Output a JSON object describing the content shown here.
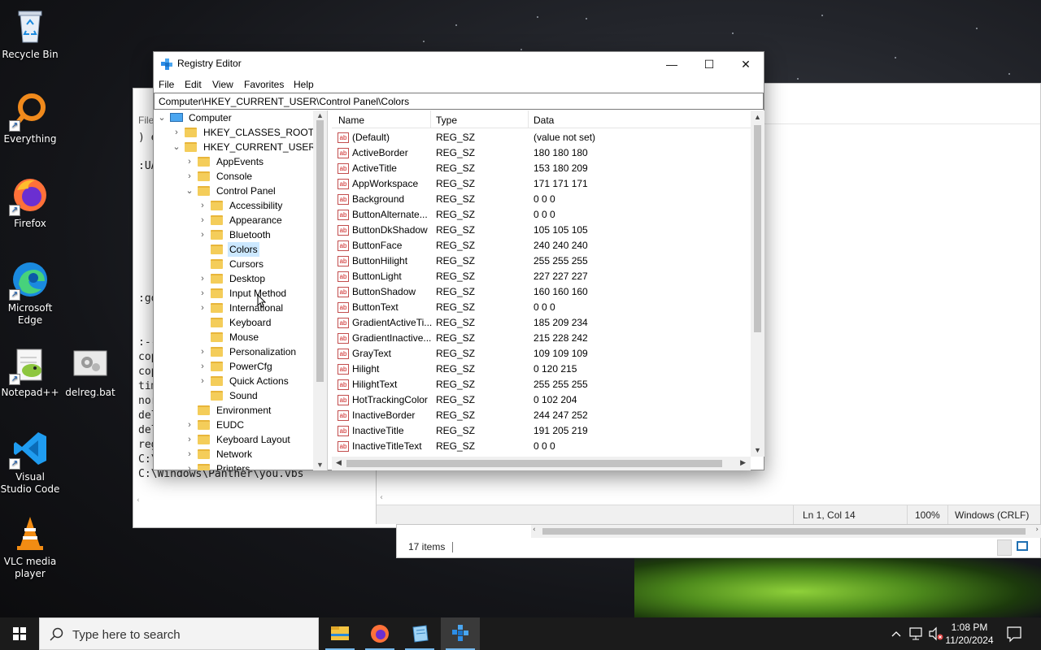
{
  "desktop": {
    "icons": [
      {
        "label": "Recycle Bin"
      },
      {
        "label": "Everything"
      },
      {
        "label": "Firefox"
      },
      {
        "label": "Microsoft Edge"
      },
      {
        "label": "Notepad++"
      },
      {
        "label": "delreg.bat"
      },
      {
        "label": "Visual Studio Code"
      },
      {
        "label": "VLC media player"
      }
    ]
  },
  "notepad_back": {
    "menu_file": "File",
    "lines": [
      ") e",
      ":UA",
      ":go",
      ":--",
      "cop",
      "cop",
      "tim",
      "nor",
      "del",
      "del",
      "reg",
      "C:\\",
      "C:\\Windows\\Panther\\you.vbs"
    ],
    "status": {
      "position": "Ln 1, Col 14",
      "zoom": "100%",
      "line_ending": "Windows (CRLF)"
    }
  },
  "explorer_strip": {
    "items_count": "17 items"
  },
  "regedit": {
    "title": "Registry Editor",
    "menu": [
      "File",
      "Edit",
      "View",
      "Favorites",
      "Help"
    ],
    "address": "Computer\\HKEY_CURRENT_USER\\Control Panel\\Colors",
    "tree": [
      {
        "label": "Computer",
        "level": 0,
        "expander": "v"
      },
      {
        "label": "HKEY_CLASSES_ROOT",
        "level": 1,
        "expander": ">"
      },
      {
        "label": "HKEY_CURRENT_USER",
        "level": 1,
        "expander": "v"
      },
      {
        "label": "AppEvents",
        "level": 2,
        "expander": ">"
      },
      {
        "label": "Console",
        "level": 2,
        "expander": ">"
      },
      {
        "label": "Control Panel",
        "level": 2,
        "expander": "v"
      },
      {
        "label": "Accessibility",
        "level": 3,
        "expander": ">"
      },
      {
        "label": "Appearance",
        "level": 3,
        "expander": ">"
      },
      {
        "label": "Bluetooth",
        "level": 3,
        "expander": ">"
      },
      {
        "label": "Colors",
        "level": 3,
        "expander": "",
        "selected": true
      },
      {
        "label": "Cursors",
        "level": 3,
        "expander": ""
      },
      {
        "label": "Desktop",
        "level": 3,
        "expander": ">"
      },
      {
        "label": "Input Method",
        "level": 3,
        "expander": ">"
      },
      {
        "label": "International",
        "level": 3,
        "expander": ">"
      },
      {
        "label": "Keyboard",
        "level": 3,
        "expander": ""
      },
      {
        "label": "Mouse",
        "level": 3,
        "expander": ""
      },
      {
        "label": "Personalization",
        "level": 3,
        "expander": ">"
      },
      {
        "label": "PowerCfg",
        "level": 3,
        "expander": ">"
      },
      {
        "label": "Quick Actions",
        "level": 3,
        "expander": ">"
      },
      {
        "label": "Sound",
        "level": 3,
        "expander": ""
      },
      {
        "label": "Environment",
        "level": 2,
        "expander": ""
      },
      {
        "label": "EUDC",
        "level": 2,
        "expander": ">"
      },
      {
        "label": "Keyboard Layout",
        "level": 2,
        "expander": ">"
      },
      {
        "label": "Network",
        "level": 2,
        "expander": ">"
      },
      {
        "label": "Printers",
        "level": 2,
        "expander": ">"
      }
    ],
    "columns": [
      "Name",
      "Type",
      "Data"
    ],
    "values": [
      {
        "name": "(Default)",
        "type": "REG_SZ",
        "data": "(value not set)"
      },
      {
        "name": "ActiveBorder",
        "type": "REG_SZ",
        "data": "180 180 180"
      },
      {
        "name": "ActiveTitle",
        "type": "REG_SZ",
        "data": "153 180 209"
      },
      {
        "name": "AppWorkspace",
        "type": "REG_SZ",
        "data": "171 171 171"
      },
      {
        "name": "Background",
        "type": "REG_SZ",
        "data": "0 0 0"
      },
      {
        "name": "ButtonAlternate...",
        "type": "REG_SZ",
        "data": "0 0 0"
      },
      {
        "name": "ButtonDkShadow",
        "type": "REG_SZ",
        "data": "105 105 105"
      },
      {
        "name": "ButtonFace",
        "type": "REG_SZ",
        "data": "240 240 240"
      },
      {
        "name": "ButtonHilight",
        "type": "REG_SZ",
        "data": "255 255 255"
      },
      {
        "name": "ButtonLight",
        "type": "REG_SZ",
        "data": "227 227 227"
      },
      {
        "name": "ButtonShadow",
        "type": "REG_SZ",
        "data": "160 160 160"
      },
      {
        "name": "ButtonText",
        "type": "REG_SZ",
        "data": "0 0 0"
      },
      {
        "name": "GradientActiveTi...",
        "type": "REG_SZ",
        "data": "185 209 234"
      },
      {
        "name": "GradientInactive...",
        "type": "REG_SZ",
        "data": "215 228 242"
      },
      {
        "name": "GrayText",
        "type": "REG_SZ",
        "data": "109 109 109"
      },
      {
        "name": "Hilight",
        "type": "REG_SZ",
        "data": "0 120 215"
      },
      {
        "name": "HilightText",
        "type": "REG_SZ",
        "data": "255 255 255"
      },
      {
        "name": "HotTrackingColor",
        "type": "REG_SZ",
        "data": "0 102 204"
      },
      {
        "name": "InactiveBorder",
        "type": "REG_SZ",
        "data": "244 247 252"
      },
      {
        "name": "InactiveTitle",
        "type": "REG_SZ",
        "data": "191 205 219"
      },
      {
        "name": "InactiveTitleText",
        "type": "REG_SZ",
        "data": "0 0 0"
      }
    ]
  },
  "taskbar": {
    "search_placeholder": "Type here to search",
    "time": "1:08 PM",
    "date": "11/20/2024"
  },
  "colors": {
    "selection": "#cce8ff",
    "taskbar": "#1b1b1b",
    "accent": "#76b9ed"
  }
}
